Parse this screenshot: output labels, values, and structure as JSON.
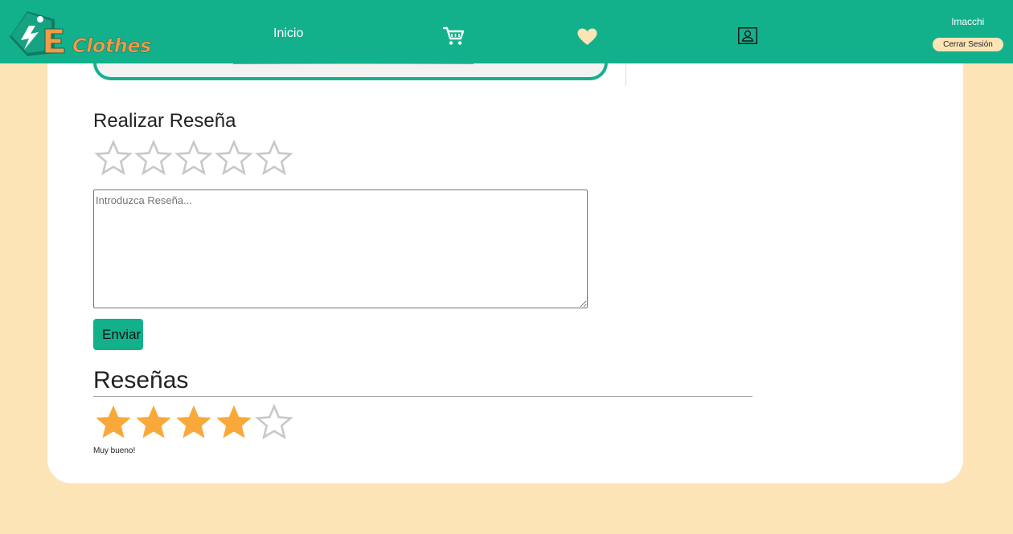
{
  "navbar": {
    "brand_text": "Clothes",
    "inicio_label": "Inicio",
    "username": "lmacchi",
    "logout_label": "Cerrar Sesión",
    "icons": [
      "logo-icon",
      "cart-icon",
      "heart-icon",
      "user-icon"
    ]
  },
  "review_form": {
    "title": "Realizar Reseña",
    "rating": 0,
    "max_rating": 5,
    "textarea_value": "",
    "textarea_placeholder": "Introduzca Reseña...",
    "submit_label": "Enviar"
  },
  "reviews": {
    "title": "Reseñas",
    "items": [
      {
        "rating": 4,
        "max_rating": 5,
        "comment": "Muy bueno!"
      }
    ]
  },
  "colors": {
    "brand_green": "#12b18c",
    "page_background": "#fde4b6",
    "star_filled": "#f9a83a",
    "star_empty_outline": "#c8c8c8",
    "brand_orange": "#f39a45"
  }
}
